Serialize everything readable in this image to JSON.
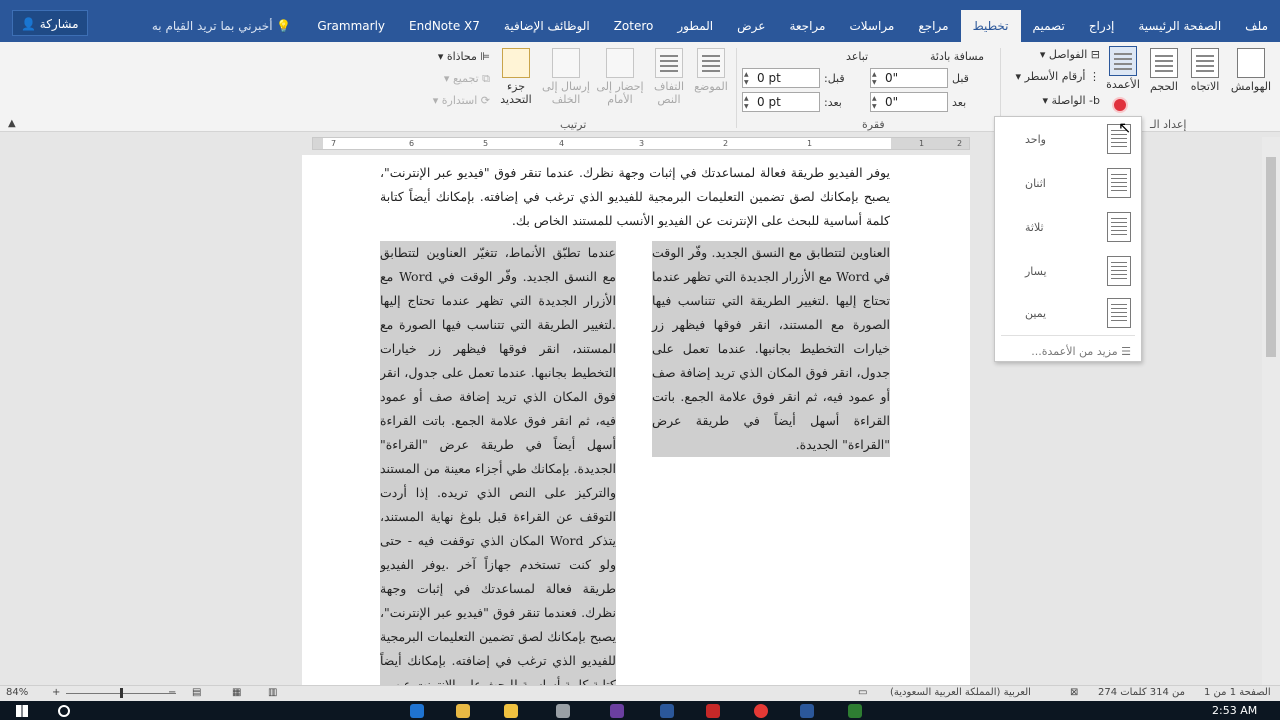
{
  "tabs": [
    "ملف",
    "الصفحة الرئيسية",
    "إدراج",
    "تصميم",
    "تخطيط",
    "مراجع",
    "مراسلات",
    "مراجعة",
    "عرض",
    "المطور",
    "Zotero",
    "الوظائف الإضافية",
    "EndNote X7",
    "Grammarly"
  ],
  "active_tab": "تخطيط",
  "tell_me": "أخبرني بما تريد القيام به",
  "share_label": "مشاركة",
  "ribbon": {
    "page_setup": {
      "margins": "الهوامش",
      "orientation": "الاتجاه",
      "size": "الحجم",
      "columns": "الأعمدة",
      "breaks": "الفواصل",
      "line_numbers": "أرقام الأسطر",
      "hyphenation": "الواصلة",
      "group_label": "إعداد الـ"
    },
    "paragraph": {
      "indent_label": "مسافة بادئة",
      "spacing_label": "تباعد",
      "before_label": "قبل",
      "after_label": "بعد",
      "indent_before_label": "قبل:",
      "indent_after_label": "بعد:",
      "indent_before_value": "0\"",
      "indent_after_value": "0\"",
      "spacing_before_value": "0 pt",
      "spacing_after_value": "0 pt",
      "group_label": "فقرة"
    },
    "arrange": {
      "position": "الموضع",
      "wrap_text": "التفاف النص",
      "bring_forward": "إحضار إلى الأمام",
      "send_backward": "إرسال إلى الخلف",
      "selection_pane": "جزء التحديد",
      "align": "محاذاة",
      "group": "تجميع",
      "rotate": "استدارة",
      "group_label": "ترتيب"
    }
  },
  "ruler_numbers": [
    "7",
    "6",
    "5",
    "4",
    "3",
    "2",
    "1",
    "1",
    "2"
  ],
  "document": {
    "intro": "يوفر الفيديو طريقة فعالة لمساعدتك في إثبات وجهة نظرك. عندما تنقر فوق \"فيديو عبر الإنترنت\"، يصبح بإمكانك لصق تضمين التعليمات البرمجية للفيديو الذي ترغب في إضافته. بإمكانك أيضاً كتابة كلمة أساسية للبحث على الإنترنت عن الفيديو الأنسب للمستند الخاص بك.",
    "col_right": "العناوين لتتطابق مع النسق الجديد. وفّر الوقت في Word مع الأزرار الجديدة التي تظهر عندما تحتاج إليها .لتغيير الطريقة التي تتناسب فيها الصورة مع المستند، انقر فوقها فيظهر زر خيارات التخطيط بجانبها. عندما تعمل على جدول، انقر فوق المكان الذي تريد إضافة صف أو عمود فيه، ثم انقر فوق علامة الجمع. باتت القراءة أسهل أيضاً في طريقة عرض \"القراءة\" الجديدة.",
    "col_left": "عندما تطبّق الأنماط، تتغيّر العناوين لتتطابق مع النسق الجديد. وفّر الوقت في Word مع الأزرار الجديدة التي تظهر عندما تحتاج إليها .لتغيير الطريقة التي تتناسب فيها الصورة مع المستند، انقر فوقها فيظهر زر خيارات التخطيط بجانبها. عندما تعمل على جدول، انقر فوق المكان الذي تريد إضافة صف أو عمود فيه، ثم انقر فوق علامة الجمع. باتت القراءة أسهل أيضاً في طريقة عرض \"القراءة\" الجديدة. بإمكانك طي أجزاء معينة من المستند والتركيز على النص الذي تريده. إذا أردت التوقف عن القراءة قبل بلوغ نهاية المستند، يتذكر Word المكان الذي توقفت فيه - حتى ولو كنت تستخدم جهازاً آخر .يوفر الفيديو طريقة فعالة لمساعدتك في إثبات وجهة نظرك. فعندما تنقر فوق \"فيديو عبر الإنترنت\"، يصبح بإمكانك لصق تضمين التعليمات البرمجية للفيديو الذي ترغب في إضافته. بإمكانك أيضاً كتابة كلمة أساسية للبحث على الإنترنت عن"
  },
  "columns_menu": {
    "items": [
      "واحد",
      "اثنان",
      "ثلاثة",
      "يسار",
      "يمين"
    ],
    "more": "مزيد من الأعمدة..."
  },
  "status": {
    "page": "الصفحة 1 من 1",
    "words": "274 من 314 كلمات",
    "language": "العربية (المملكة العربية السعودية)",
    "zoom": "84%"
  },
  "taskbar": {
    "time": "2:53 AM"
  },
  "colors": {
    "accent": "#2b579a",
    "selection": "#c8c8c8",
    "record": "#e0313d"
  }
}
